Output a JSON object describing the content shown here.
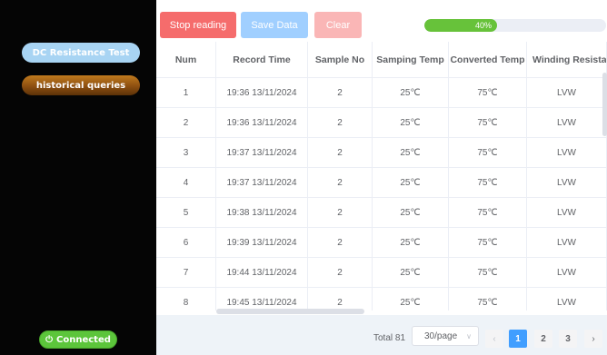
{
  "sidebar": {
    "dc_test_label": "DC Resistance Test",
    "history_label": "historical queries",
    "connection": {
      "icon": "power-icon",
      "label": "Connected"
    }
  },
  "toolbar": {
    "stop_label": "Stop reading",
    "save_label": "Save Data",
    "clear_label": "Clear",
    "progress": {
      "value": 0.4,
      "label": "40%"
    }
  },
  "table": {
    "columns": [
      "Num",
      "Record Time",
      "Sample No",
      "Samping Temp",
      "Converted Temp",
      "Winding Resista"
    ],
    "rows": [
      [
        "1",
        "19:36 13/11/2024",
        "2",
        "25℃",
        "75℃",
        "LVW"
      ],
      [
        "2",
        "19:36 13/11/2024",
        "2",
        "25℃",
        "75℃",
        "LVW"
      ],
      [
        "3",
        "19:37 13/11/2024",
        "2",
        "25℃",
        "75℃",
        "LVW"
      ],
      [
        "4",
        "19:37 13/11/2024",
        "2",
        "25℃",
        "75℃",
        "LVW"
      ],
      [
        "5",
        "19:38 13/11/2024",
        "2",
        "25℃",
        "75℃",
        "LVW"
      ],
      [
        "6",
        "19:39 13/11/2024",
        "2",
        "25℃",
        "75℃",
        "LVW"
      ],
      [
        "7",
        "19:44 13/11/2024",
        "2",
        "25℃",
        "75℃",
        "LVW"
      ],
      [
        "8",
        "19:45 13/11/2024",
        "2",
        "25℃",
        "75℃",
        "LVW"
      ]
    ]
  },
  "pagination": {
    "total_label": "Total 81",
    "page_size_label": "30/page",
    "pages": [
      "1",
      "2",
      "3"
    ],
    "current_page": "1",
    "prev_icon": "‹",
    "next_icon": "›",
    "dropdown_icon": "∨"
  },
  "colors": {
    "stop": "#f56c6c",
    "save": "#a0cfff",
    "clear": "#fab6b6",
    "progress": "#67c23a",
    "active_page": "#409eff",
    "connected": "#5cc53b"
  }
}
